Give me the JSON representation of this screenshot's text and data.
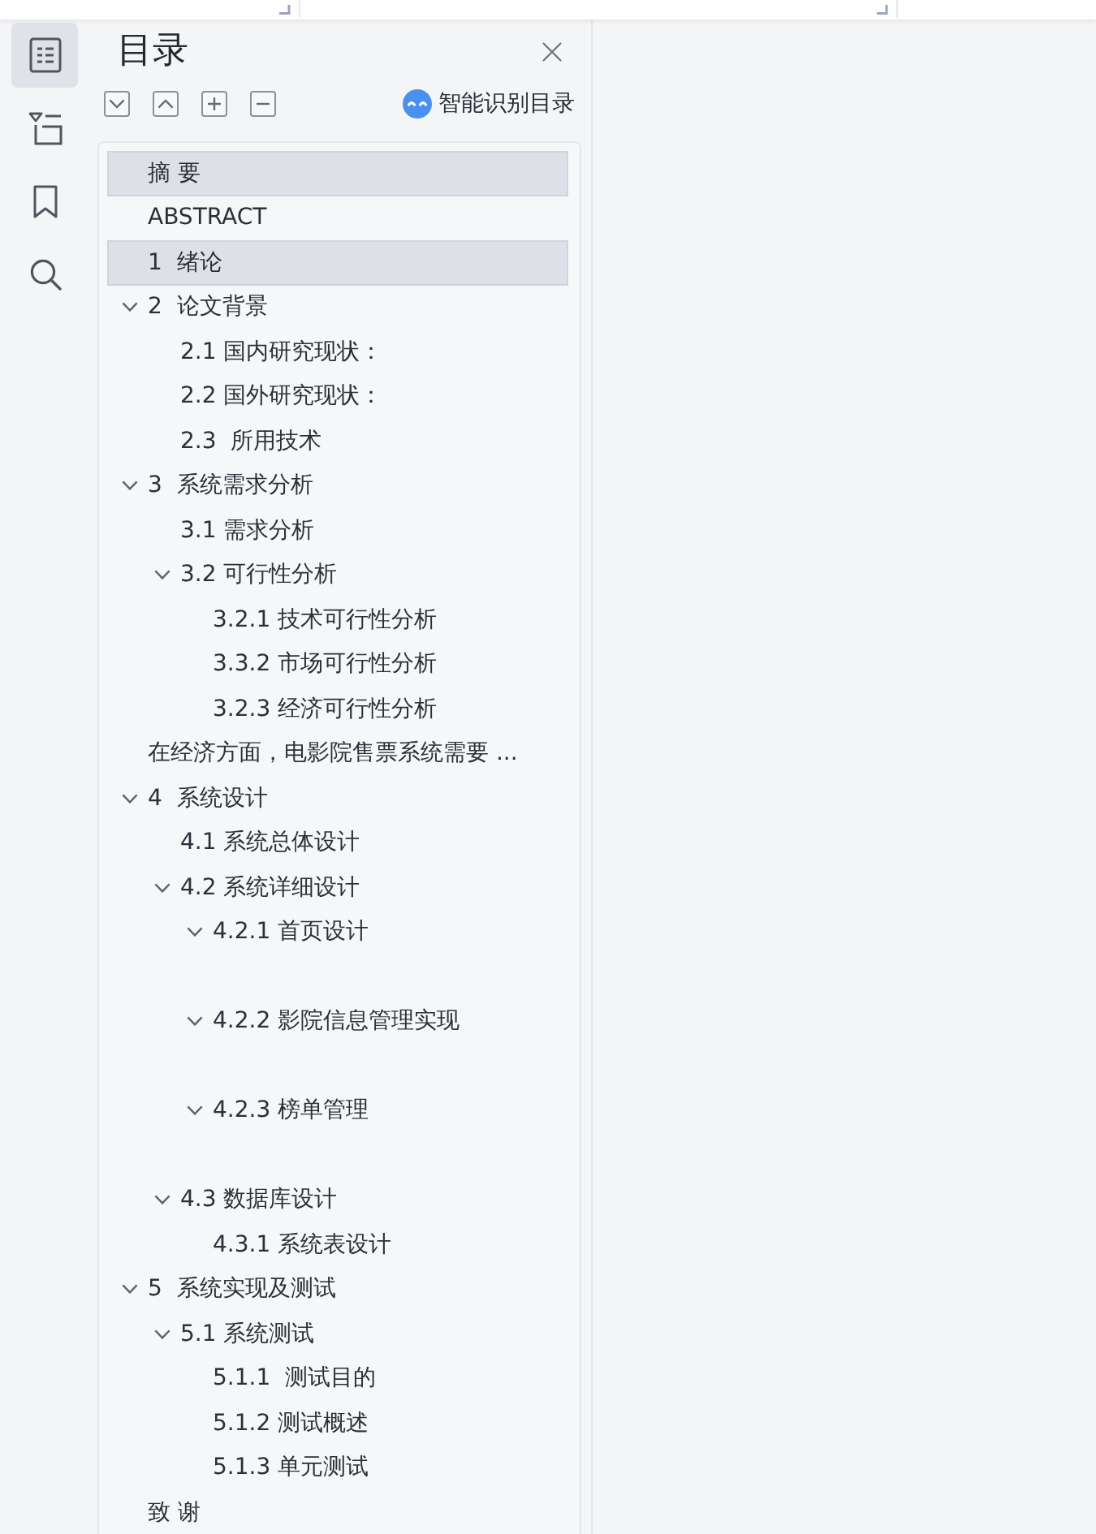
{
  "icon_rail": {
    "items": [
      {
        "kind": "contents",
        "selected": true
      },
      {
        "kind": "outline",
        "selected": false
      },
      {
        "kind": "bookmark",
        "selected": false
      },
      {
        "kind": "search",
        "selected": false
      }
    ]
  },
  "panel": {
    "title": "目录",
    "toolbar": {
      "buttons": [
        {
          "kind": "expand"
        },
        {
          "kind": "collapse"
        },
        {
          "kind": "add"
        },
        {
          "kind": "remove"
        }
      ],
      "smart_button": {
        "label": "智能识别目录"
      }
    }
  },
  "toc": [
    {
      "title": "摘 要",
      "selected": true
    },
    {
      "title": "ABSTRACT",
      "selected": false
    },
    {
      "title": "1  绪论",
      "selected": true
    },
    {
      "title": "2  论文背景",
      "selected": false,
      "expanded": true,
      "children": [
        {
          "title": "2.1 国内研究现状：",
          "selected": false
        },
        {
          "title": "2.2 国外研究现状：",
          "selected": false
        },
        {
          "title": "2.3  所用技术",
          "selected": false
        }
      ]
    },
    {
      "title": "3  系统需求分析",
      "selected": false,
      "expanded": true,
      "children": [
        {
          "title": "3.1 需求分析",
          "selected": false
        },
        {
          "title": "3.2 可行性分析",
          "selected": false,
          "expanded": true,
          "children": [
            {
              "title": "3.2.1 技术可行性分析",
              "selected": false
            },
            {
              "title": "3.3.2 市场可行性分析",
              "selected": false
            },
            {
              "title": "3.2.3 经济可行性分析",
              "selected": false
            }
          ]
        }
      ]
    },
    {
      "title": "在经济方面，电影院售票系统需要 ...",
      "selected": false
    },
    {
      "title": "4  系统设计",
      "selected": false,
      "expanded": true,
      "children": [
        {
          "title": "4.1 系统总体设计",
          "selected": false
        },
        {
          "title": "4.2 系统详细设计",
          "selected": false,
          "expanded": true,
          "children": [
            {
              "title": "4.2.1 首页设计",
              "selected": false,
              "expanded": true
            },
            {
              "title": "4.2.2 影院信息管理实现",
              "selected": false,
              "expanded": true
            },
            {
              "title": "4.2.3 榜单管理",
              "selected": false,
              "expanded": true
            }
          ]
        },
        {
          "title": "4.3 数据库设计",
          "selected": false,
          "expanded": true,
          "children": [
            {
              "title": "4.3.1 系统表设计",
              "selected": false
            }
          ]
        }
      ]
    },
    {
      "title": "5  系统实现及测试",
      "selected": false,
      "expanded": true,
      "children": [
        {
          "title": "5.1 系统测试",
          "selected": false,
          "expanded": true,
          "children": [
            {
              "title": "5.1.1  测试目的",
              "selected": false
            },
            {
              "title": "5.1.2 测试概述",
              "selected": false
            },
            {
              "title": "5.1.3 单元测试",
              "selected": false
            }
          ]
        }
      ]
    },
    {
      "title": "致 谢",
      "selected": false
    }
  ]
}
